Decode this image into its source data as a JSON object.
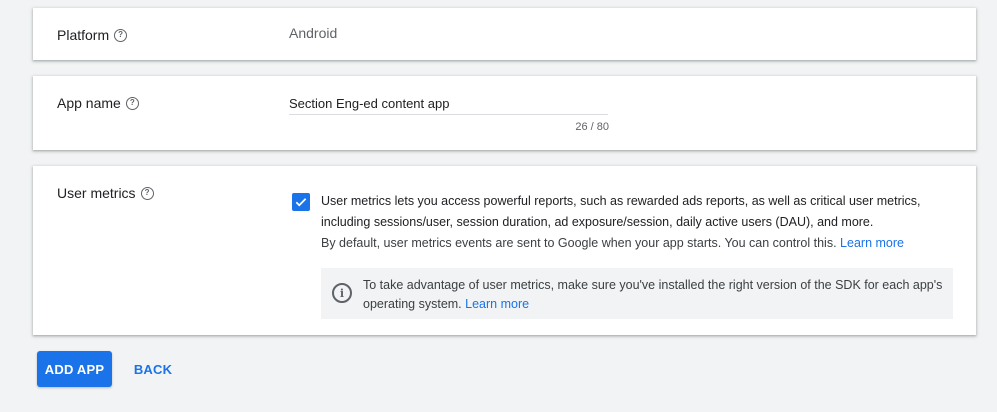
{
  "platform": {
    "label": "Platform",
    "help_icon": "help-circle-icon",
    "value": "Android"
  },
  "app_name": {
    "label": "App name",
    "help_icon": "help-circle-icon",
    "value": "Section Eng-ed content app",
    "counter": "26 / 80"
  },
  "user_metrics": {
    "label": "User metrics",
    "help_icon": "help-circle-icon",
    "checked": true,
    "description": "User metrics lets you access powerful reports, such as rewarded ads reports, as well as critical user metrics, including sessions/user, session duration, ad exposure/session, daily active users (DAU), and more.",
    "default_text": "By default, user metrics events are sent to Google when your app starts. You can control this.",
    "default_link": "Learn more",
    "info_text": "To take advantage of user metrics, make sure you've installed the right version of the SDK for each app's operating system.",
    "info_link": "Learn more",
    "info_icon": "info-icon"
  },
  "actions": {
    "add_app": "ADD APP",
    "back": "BACK"
  },
  "colors": {
    "accent": "#1a73e8",
    "background": "#f1f3f4",
    "card": "#ffffff"
  }
}
